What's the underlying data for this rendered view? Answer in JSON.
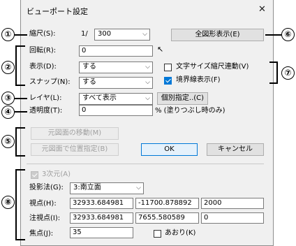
{
  "dialog": {
    "title": "ビューポート設定",
    "close": "✕"
  },
  "scale": {
    "label": "縮尺(S):",
    "prefix": "1/",
    "value": "300"
  },
  "show_all_button": "全図形表示(E)",
  "rotation": {
    "label": "回転(R):",
    "value": "0"
  },
  "display": {
    "label": "表示(D):",
    "value": "する"
  },
  "snap": {
    "label": "スナップ(N):",
    "value": "する"
  },
  "text_size_link": {
    "label": "文字サイズ縮尺連動(V)",
    "checked": false
  },
  "border_display": {
    "label": "境界線表示(F)",
    "checked": true
  },
  "layer": {
    "label": "レイヤ(L):",
    "value": "すべて表示",
    "button": "個別指定..(C)"
  },
  "opacity": {
    "label": "透明度(T):",
    "value": "0",
    "note": "% (塗りつぶし時のみ)"
  },
  "move_original_button": "元図面の移動(M)",
  "position_original_button": "元図面で位置指定(B)",
  "ok_button": "OK",
  "cancel_button": "キャンセル",
  "three_d": {
    "label": "3次元(A)",
    "checked": true,
    "enabled": false
  },
  "projection": {
    "label": "投影法(G):",
    "value": "3:南立面"
  },
  "viewpoint": {
    "label": "視点(H):",
    "x": "32933.684981",
    "y": "-11700.878892",
    "z": "2000"
  },
  "gaze_point": {
    "label": "注視点(I):",
    "x": "32933.684981",
    "y": "7655.580589",
    "z": "0"
  },
  "focal": {
    "label": "焦点(J):",
    "value": "35"
  },
  "tilt": {
    "label": "あおり(K)",
    "checked": false
  },
  "annotations": [
    "①",
    "②",
    "③",
    "④",
    "⑤",
    "⑥",
    "⑦",
    "⑧"
  ]
}
